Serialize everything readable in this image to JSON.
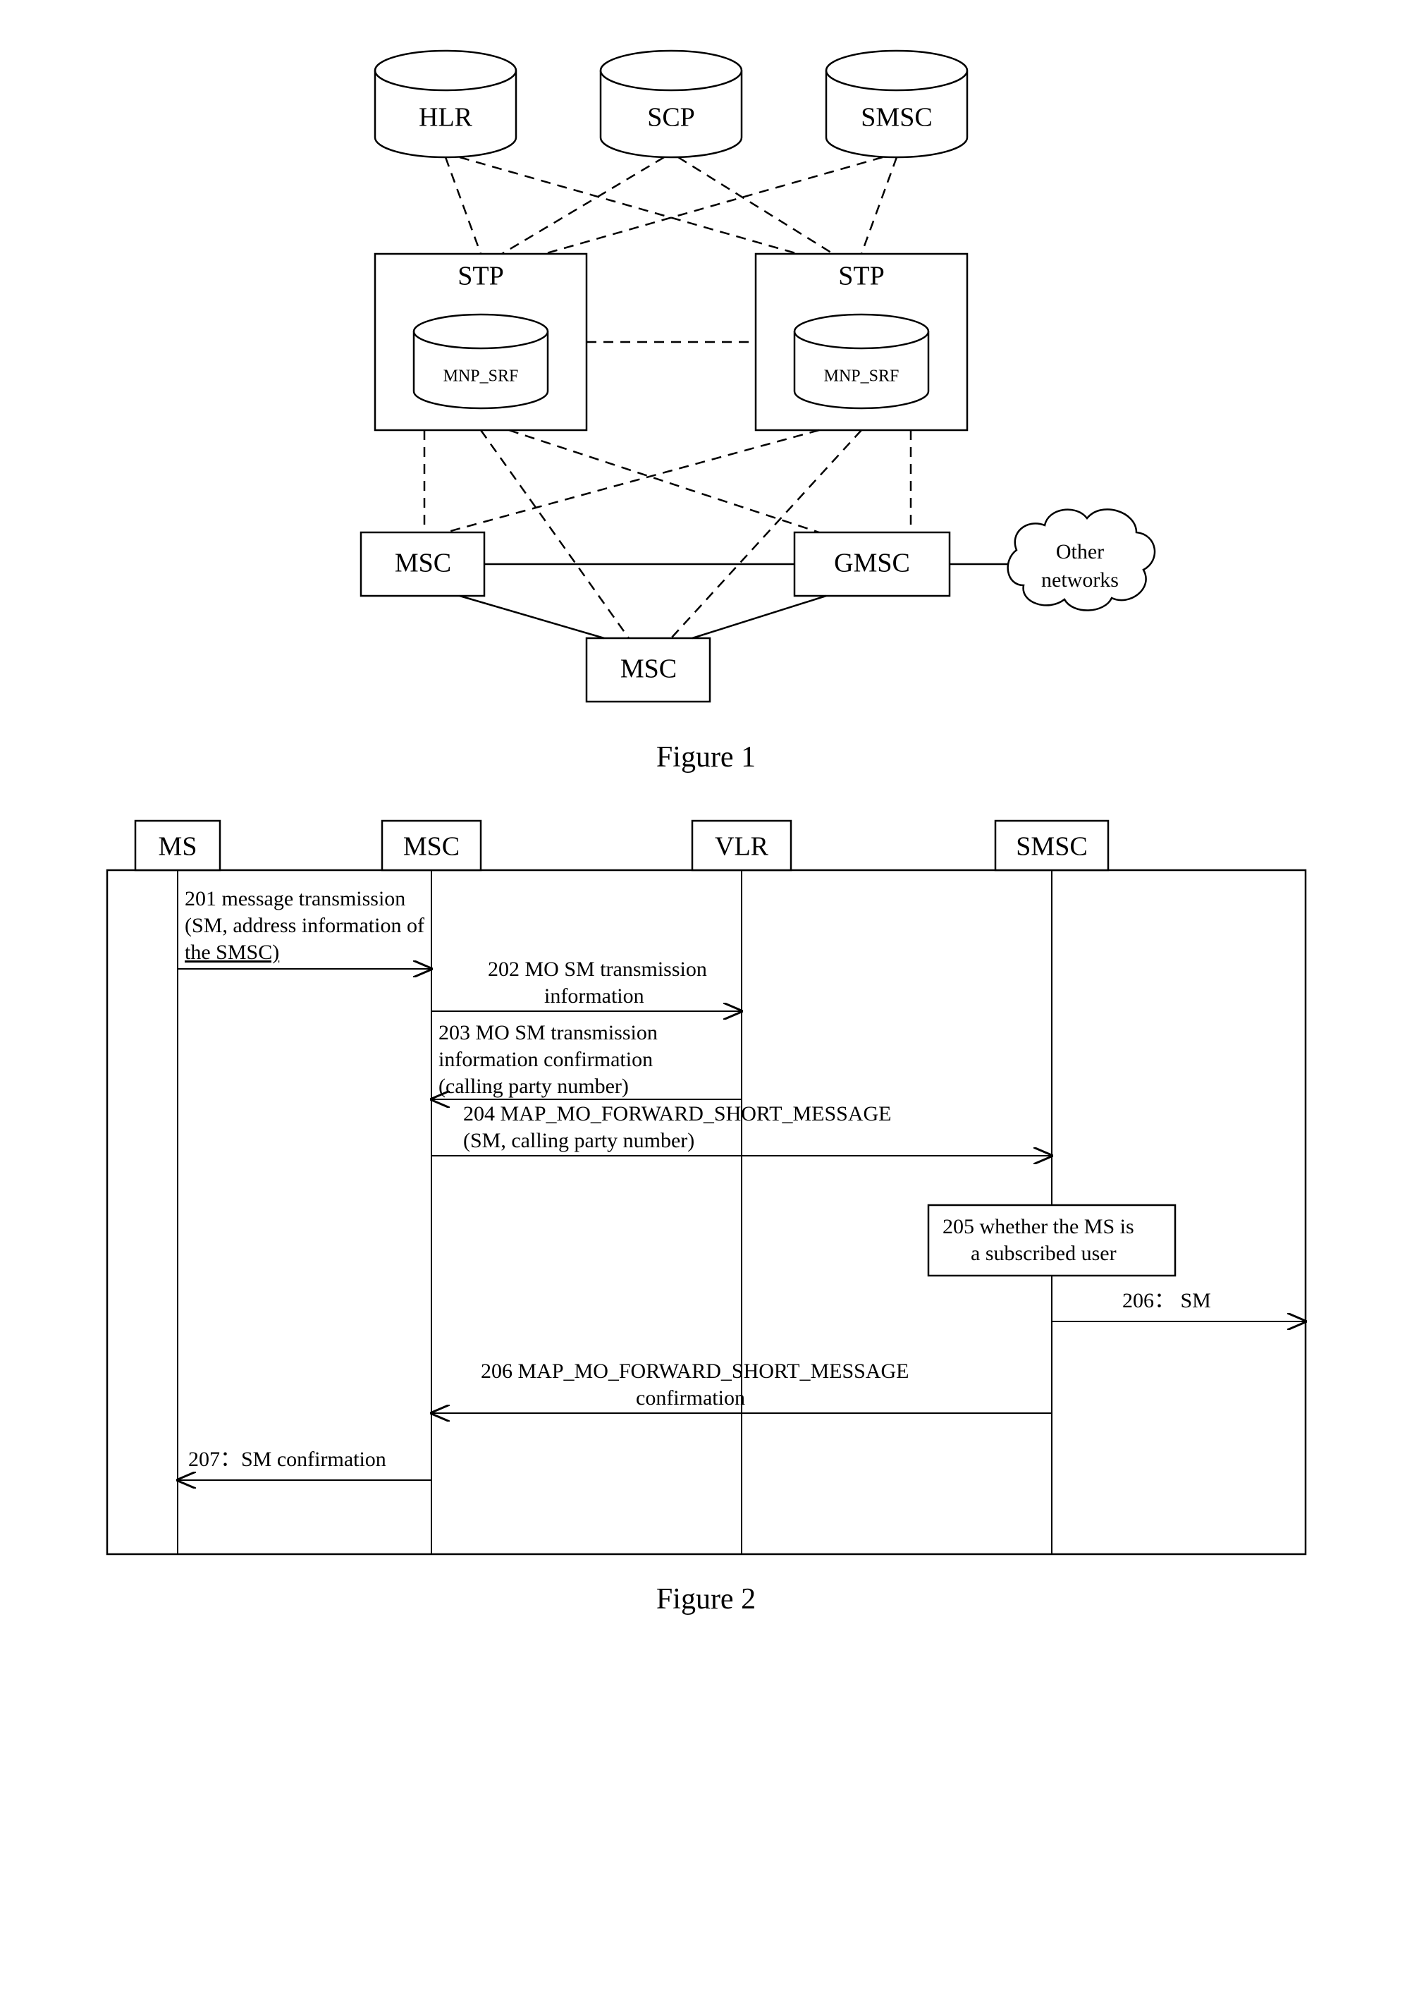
{
  "figure1": {
    "caption": "Figure 1",
    "nodes": {
      "hlr": "HLR",
      "scp": "SCP",
      "smsc": "SMSC",
      "stp_left": "STP",
      "stp_right": "STP",
      "mnp_srf_left": "MNP_SRF",
      "mnp_srf_right": "MNP_SRF",
      "msc_left": "MSC",
      "msc_bottom": "MSC",
      "gmsc": "GMSC",
      "other_networks_l1": "Other",
      "other_networks_l2": "networks"
    }
  },
  "figure2": {
    "caption": "Figure 2",
    "lifelines": {
      "ms": "MS",
      "msc": "MSC",
      "vlr": "VLR",
      "smsc": "SMSC"
    },
    "messages": {
      "m201_l1": "201   message transmission",
      "m201_l2": "(SM, address information of",
      "m201_l3": "the SMSC)",
      "m202_l1": "202 MO SM transmission",
      "m202_l2": "information",
      "m203_l1": "203    MO   SM   transmission",
      "m203_l2": "information            confirmation",
      "m203_l3": "(calling party number)",
      "m204_l1": "204       MAP_MO_FORWARD_SHORT_MESSAGE",
      "m204_l2": "(SM, calling party number)",
      "m205_l1": "205 whether the MS is",
      "m205_l2": "a subscribed user",
      "m206_right": "206：  SM",
      "m206_conf_l1": "206 MAP_MO_FORWARD_SHORT_MESSAGE",
      "m206_conf_l2": "confirmation",
      "m207": "207：SM confirmation"
    }
  }
}
